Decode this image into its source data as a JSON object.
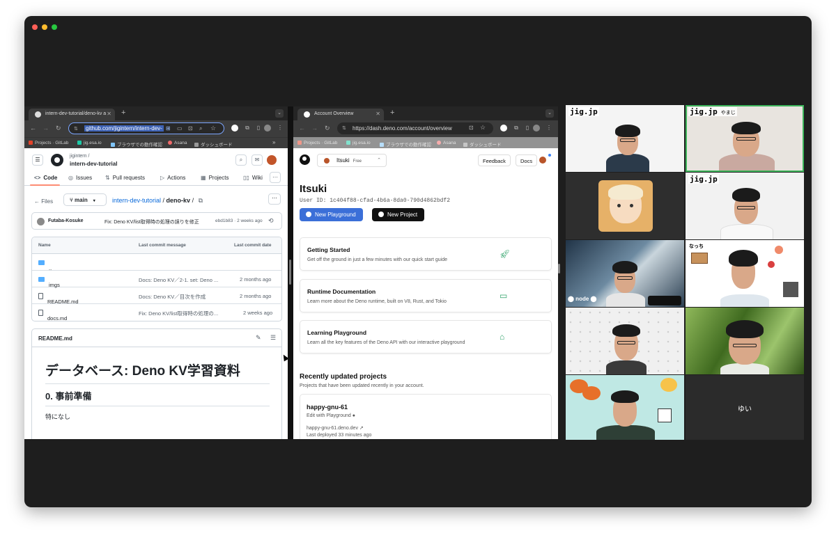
{
  "left_browser": {
    "tab_title": "intern-dev-tutorial/deno-kv a",
    "url": "github.com/jigintern/intern-dev-",
    "bookmarks": [
      "Projects · GitLab",
      "jig.esa.io",
      "ブラウザでの動作確認",
      "Asana",
      "ダッシュボード"
    ],
    "more": "»"
  },
  "github": {
    "owner": "jigintern /",
    "repo": "intern-dev-tutorial",
    "tabs": [
      {
        "icon": "<>",
        "label": "Code"
      },
      {
        "icon": "◎",
        "label": "Issues"
      },
      {
        "icon": "⇅",
        "label": "Pull requests"
      },
      {
        "icon": "▷",
        "label": "Actions"
      },
      {
        "icon": "▦",
        "label": "Projects"
      },
      {
        "icon": "▯▯",
        "label": "Wiki"
      }
    ],
    "files_link": "Files",
    "branch": "main",
    "breadcrumb_repo": "intern-dev-tutorial",
    "breadcrumb_sep": " / ",
    "breadcrumb_dir": "deno-kv",
    "breadcrumb_tail": " /",
    "commit": {
      "author": "Futaba-Kosuke",
      "message": "Fix: Deno KV/list取得時の処理の誤りを修正",
      "meta": "ebd1b83 · 2 weeks ago"
    },
    "table_headers": {
      "name": "Name",
      "message": "Last commit message",
      "date": "Last commit date"
    },
    "files": [
      {
        "name": "..",
        "message": "",
        "date": ""
      },
      {
        "name": "imgs",
        "message": "Docs: Deno KV／2-1. set: Deno ...",
        "date": "2 months ago"
      },
      {
        "name": "README.md",
        "message": "Docs: Deno KV／目次を作成",
        "date": "2 months ago"
      },
      {
        "name": "docs.md",
        "message": "Fix: Deno KV/list取得時の処理の...",
        "date": "2 weeks ago"
      }
    ],
    "readme": {
      "title": "README.md",
      "h1": "データベース: Deno KV学習資料",
      "h2": "0. 事前準備",
      "p": "特になし"
    }
  },
  "right_browser": {
    "tab_title": "Account Overview",
    "url": "https://dash.deno.com/account/overview",
    "bookmarks": [
      "Projects · GitLab",
      "jig.esa.io",
      "ブラウザでの動作確認",
      "Asana",
      "ダッシュボード"
    ]
  },
  "deno": {
    "account": "Itsuki",
    "plan": "Free",
    "feedback": "Feedback",
    "docs": "Docs",
    "username": "Itsuki",
    "user_id": "User ID: 1c404f88-cfad-4b6a-8da0-790d4862bdf2",
    "new_playground": "New Playground",
    "new_project": "New Project",
    "cards": [
      {
        "title": "Getting Started",
        "desc": "Get off the ground in just a few minutes with our quick start guide",
        "icon": "rocket-icon"
      },
      {
        "title": "Runtime Documentation",
        "desc": "Learn more about the Deno runtime, built on V8, Rust, and Tokio",
        "icon": "book-icon"
      },
      {
        "title": "Learning Playground",
        "desc": "Learn all the key features of the Deno API with our interactive playground",
        "icon": "graduation-cap-icon"
      }
    ],
    "recent_title": "Recently updated projects",
    "recent_desc": "Projects that have been updated recently in your account.",
    "project": {
      "name": "happy-gnu-61",
      "edit": "Edit with Playground",
      "url": "happy-gnu-61.deno.dev",
      "last": "Last deployed 33 minutes ago"
    }
  },
  "video": {
    "tiles": [
      {
        "label": "jig.jp",
        "name": ""
      },
      {
        "label": "jig.jp",
        "name": "やまじ"
      },
      {
        "label": "",
        "name": ""
      },
      {
        "label": "jig.jp",
        "name": ""
      },
      {
        "label": "",
        "name": ""
      },
      {
        "label": "",
        "name": "なっち"
      },
      {
        "label": "",
        "name": ""
      },
      {
        "label": "",
        "name": ""
      },
      {
        "label": "",
        "name": ""
      },
      {
        "label": "",
        "name": "ゆい"
      }
    ]
  },
  "colors": {
    "accent_blue": "#3b6fd8",
    "github_link": "#0969da",
    "active_speaker": "#3cb45a"
  }
}
